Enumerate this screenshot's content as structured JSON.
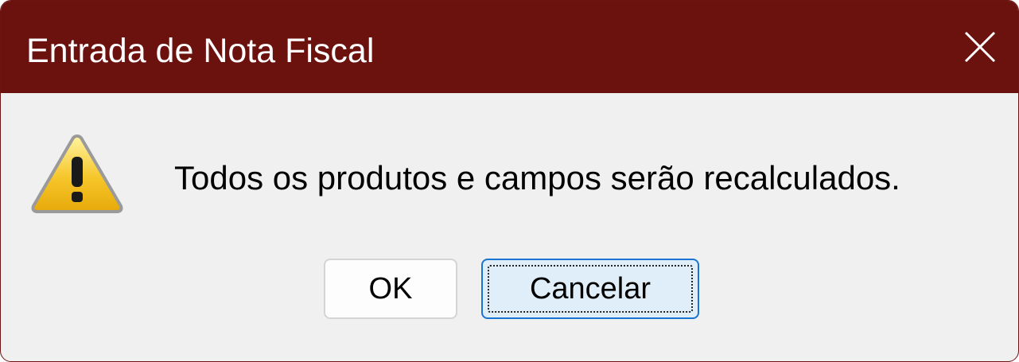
{
  "window": {
    "title": "Entrada de Nota Fiscal",
    "titlebar_color": "#6b120e",
    "close_icon": "close-icon"
  },
  "dialog": {
    "icon": "warning-icon",
    "message": "Todos os produtos e campos serão recalculados."
  },
  "buttons": {
    "ok_label": "OK",
    "cancel_label": "Cancelar",
    "focused": "Cancelar"
  }
}
